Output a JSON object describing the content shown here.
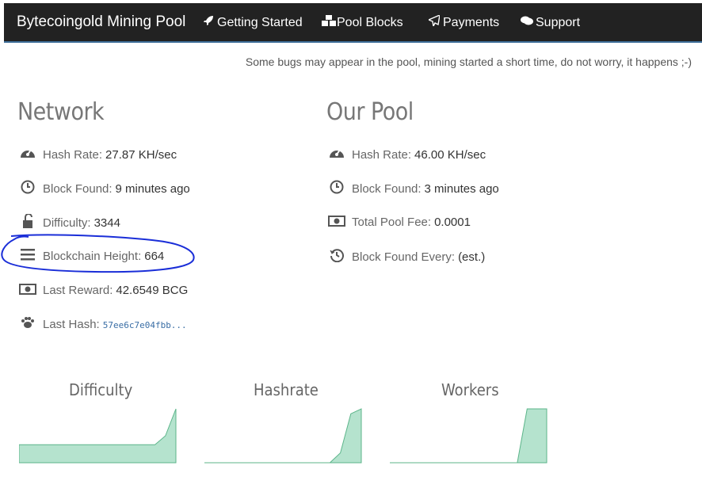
{
  "navbar": {
    "brand": "Bytecoingold Mining Pool",
    "items": [
      {
        "label": "Getting Started",
        "icon": "rocket-icon"
      },
      {
        "label": "Pool Blocks",
        "icon": "cubes-icon"
      },
      {
        "label": "Payments",
        "icon": "paper-plane-icon"
      },
      {
        "label": "Support",
        "icon": "comments-icon"
      }
    ],
    "bg_color": "#222222"
  },
  "notice": "Some bugs may appear in the pool, mining started a short time, do not worry, it happens ;-)",
  "network": {
    "title": "Network",
    "stats": [
      {
        "label": "Hash Rate:",
        "value": "27.87 KH/sec",
        "icon": "tachometer-icon"
      },
      {
        "label": "Block Found:",
        "value": "9 minutes ago",
        "icon": "clock-icon"
      },
      {
        "label": "Difficulty:",
        "value": "3344",
        "icon": "unlock-icon"
      },
      {
        "label": "Blockchain Height:",
        "value": "664",
        "icon": "bars-icon"
      },
      {
        "label": "Last Reward:",
        "value": "42.6549 BCG",
        "icon": "money-icon"
      },
      {
        "label": "Last Hash:",
        "value": "57ee6c7e04fbb...",
        "icon": "paw-icon"
      }
    ]
  },
  "pool": {
    "title": "Our Pool",
    "stats": [
      {
        "label": "Hash Rate:",
        "value": "46.00 KH/sec",
        "icon": "tachometer-icon"
      },
      {
        "label": "Block Found:",
        "value": "3 minutes ago",
        "icon": "clock-icon"
      },
      {
        "label": "Total Pool Fee:",
        "value": "0.0001",
        "icon": "money-icon"
      },
      {
        "label": "Block Found Every:",
        "value": "(est.)",
        "icon": "history-icon"
      }
    ]
  },
  "charts": [
    {
      "title": "Difficulty"
    },
    {
      "title": "Hashrate"
    },
    {
      "title": "Workers"
    }
  ],
  "chart_data": [
    {
      "type": "area",
      "title": "Difficulty",
      "values": [
        1,
        1,
        1,
        1,
        1,
        1,
        1,
        1,
        1,
        1,
        1,
        1,
        1,
        1,
        1.5,
        3
      ],
      "color": "#b5e3ce"
    },
    {
      "type": "area",
      "title": "Hashrate",
      "values": [
        0,
        0,
        0,
        0,
        0,
        0,
        0,
        0,
        0,
        0,
        0,
        0,
        0,
        0.4,
        2,
        2.2
      ],
      "color": "#b5e3ce"
    },
    {
      "type": "area",
      "title": "Workers",
      "values": [
        0,
        0,
        0,
        0,
        0,
        0,
        0,
        0,
        0,
        0,
        0,
        0,
        0,
        0,
        2,
        2,
        2
      ],
      "color": "#b5e3ce"
    }
  ]
}
